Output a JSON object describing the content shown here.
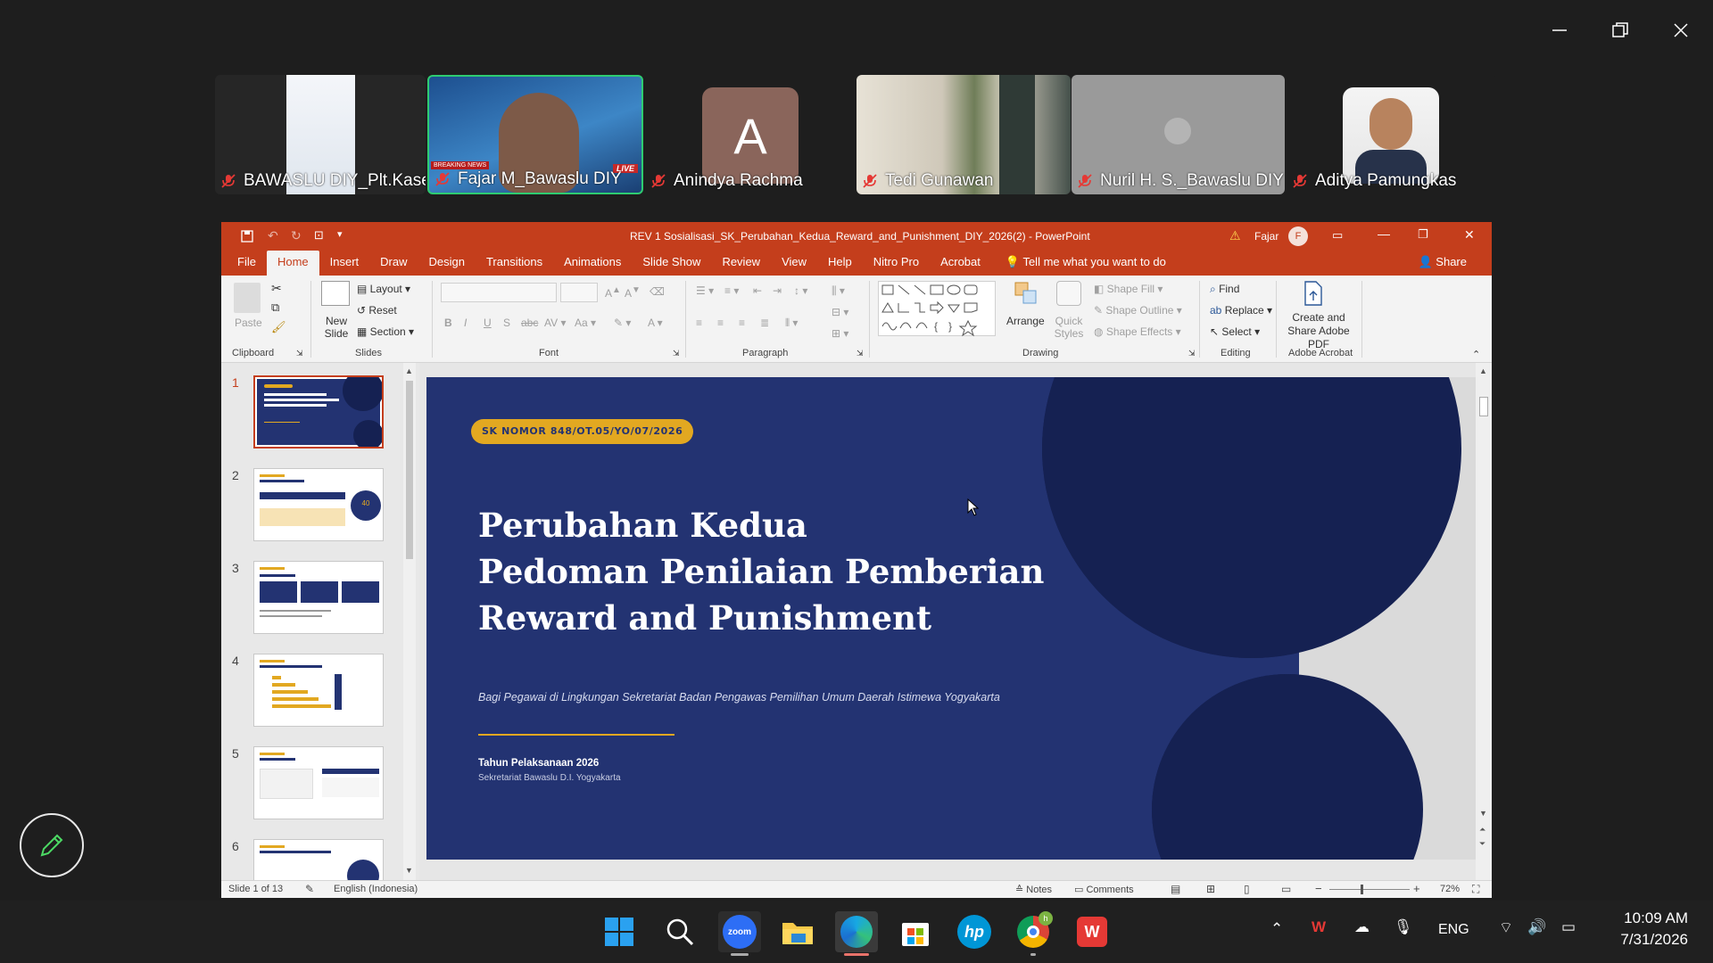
{
  "zoom": {
    "participants": [
      {
        "name": "BAWASLU DIY_Plt.Kase...",
        "muted": true
      },
      {
        "name": "Fajar M_Bawaslu DIY",
        "muted": true,
        "active_speaker": true
      },
      {
        "name": "Anindya Rachma",
        "muted": true,
        "initial": "A"
      },
      {
        "name": "Tedi Gunawan",
        "muted": true
      },
      {
        "name": "Nuril H. S._Bawaslu DIY",
        "muted": true
      },
      {
        "name": "Aditya Pamungkas",
        "muted": true
      }
    ],
    "tile_overlay": {
      "breaking": "BREAKING NEWS",
      "live": "LIVE"
    }
  },
  "ppt": {
    "title": "REV 1 Sosialisasi_SK_Perubahan_Kedua_Reward_and_Punishment_DIY_2026(2)  -  PowerPoint",
    "user_name": "Fajar",
    "user_initial": "F",
    "tabs": [
      "File",
      "Home",
      "Insert",
      "Draw",
      "Design",
      "Transitions",
      "Animations",
      "Slide Show",
      "Review",
      "View",
      "Help",
      "Nitro Pro",
      "Acrobat"
    ],
    "tell_me": "Tell me what you want to do",
    "share": "Share",
    "ribbon": {
      "paste": "Paste",
      "clipboard": "Clipboard",
      "new_slide": "New Slide",
      "layout": "Layout",
      "reset": "Reset",
      "section": "Section",
      "slides": "Slides",
      "font": "Font",
      "paragraph": "Paragraph",
      "arrange": "Arrange",
      "quick_styles": "Quick Styles",
      "shape_fill": "Shape Fill",
      "shape_outline": "Shape Outline",
      "shape_effects": "Shape Effects",
      "drawing": "Drawing",
      "find": "Find",
      "replace": "Replace",
      "select": "Select",
      "editing": "Editing",
      "create_share": "Create and Share Adobe PDF",
      "adobe_acrobat": "Adobe Acrobat"
    },
    "thumbnails": [
      "1",
      "2",
      "3",
      "4",
      "5",
      "6"
    ],
    "thumb_number": "40",
    "slide": {
      "badge": "SK NOMOR 848/OT.05/YO/07/2026",
      "title_lines": [
        "Perubahan Kedua",
        "Pedoman Penilaian Pemberian",
        "Reward and Punishment"
      ],
      "subtitle": "Bagi Pegawai di Lingkungan Sekretariat Badan Pengawas Pemilihan Umum Daerah Istimewa Yogyakarta",
      "year": "Tahun Pelaksanaan 2026",
      "org": "Sekretariat Bawaslu D.I. Yogyakarta"
    },
    "status": {
      "slide_of": "Slide 1 of 13",
      "language": "English (Indonesia)",
      "notes": "Notes",
      "comments": "Comments",
      "zoom": "72%"
    }
  },
  "taskbar": {
    "lang": "ENG",
    "time": "10:09 AM",
    "date": "7/31/2026",
    "zoom_label": "zoom",
    "hp_label": "hp"
  },
  "colors": {
    "ppt_red": "#c43e1c",
    "slide_navy": "#233372",
    "circle_navy": "#152152",
    "gold": "#e2a821",
    "active_speaker": "#2ecc71"
  }
}
